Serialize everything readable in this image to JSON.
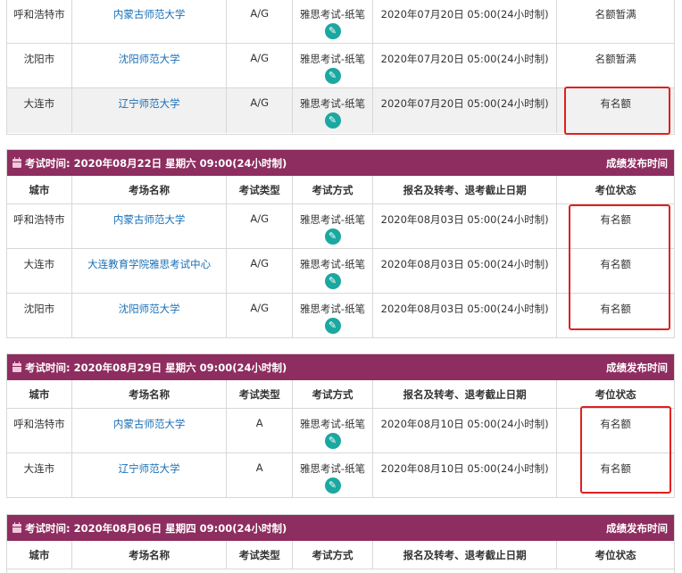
{
  "block0": {
    "rows": [
      {
        "city": "呼和浩特市",
        "venue": "内蒙古师范大学",
        "type": "A/G",
        "mode": "雅思考试-纸笔",
        "deadline": "2020年07月20日 05:00(24小时制)",
        "status": "名额暂满"
      },
      {
        "city": "沈阳市",
        "venue": "沈阳师范大学",
        "type": "A/G",
        "mode": "雅思考试-纸笔",
        "deadline": "2020年07月20日 05:00(24小时制)",
        "status": "名额暂满"
      },
      {
        "city": "大连市",
        "venue": "辽宁师范大学",
        "type": "A/G",
        "mode": "雅思考试-纸笔",
        "deadline": "2020年07月20日 05:00(24小时制)",
        "status": "有名额"
      }
    ]
  },
  "columns": {
    "city": "城市",
    "venue": "考场名称",
    "type": "考试类型",
    "mode": "考试方式",
    "deadline": "报名及转考、退考截止日期",
    "status": "考位状态"
  },
  "block1": {
    "header": "考试时间: 2020年08月22日 星期六 09:00(24小时制)",
    "link": "成绩发布时间",
    "rows": [
      {
        "city": "呼和浩特市",
        "venue": "内蒙古师范大学",
        "type": "A/G",
        "mode": "雅思考试-纸笔",
        "deadline": "2020年08月03日 05:00(24小时制)",
        "status": "有名额"
      },
      {
        "city": "大连市",
        "venue": "大连教育学院雅思考试中心",
        "type": "A/G",
        "mode": "雅思考试-纸笔",
        "deadline": "2020年08月03日 05:00(24小时制)",
        "status": "有名额"
      },
      {
        "city": "沈阳市",
        "venue": "沈阳师范大学",
        "type": "A/G",
        "mode": "雅思考试-纸笔",
        "deadline": "2020年08月03日 05:00(24小时制)",
        "status": "有名额"
      }
    ]
  },
  "block2": {
    "header": "考试时间: 2020年08月29日 星期六 09:00(24小时制)",
    "link": "成绩发布时间",
    "rows": [
      {
        "city": "呼和浩特市",
        "venue": "内蒙古师范大学",
        "type": "A",
        "mode": "雅思考试-纸笔",
        "deadline": "2020年08月10日 05:00(24小时制)",
        "status": "有名额"
      },
      {
        "city": "大连市",
        "venue": "辽宁师范大学",
        "type": "A",
        "mode": "雅思考试-纸笔",
        "deadline": "2020年08月10日 05:00(24小时制)",
        "status": "有名额"
      }
    ]
  },
  "block3": {
    "header": "考试时间: 2020年08月06日 星期四 09:00(24小时制)",
    "link": "成绩发布时间"
  },
  "icons": {
    "calendar": "calendar-icon",
    "edit": "pencil-icon"
  },
  "colors": {
    "header_bg": "#8e2d5f",
    "venue_link": "#1a6fb5",
    "edit_button": "#1aa8a0",
    "highlight_box": "#e02020"
  }
}
